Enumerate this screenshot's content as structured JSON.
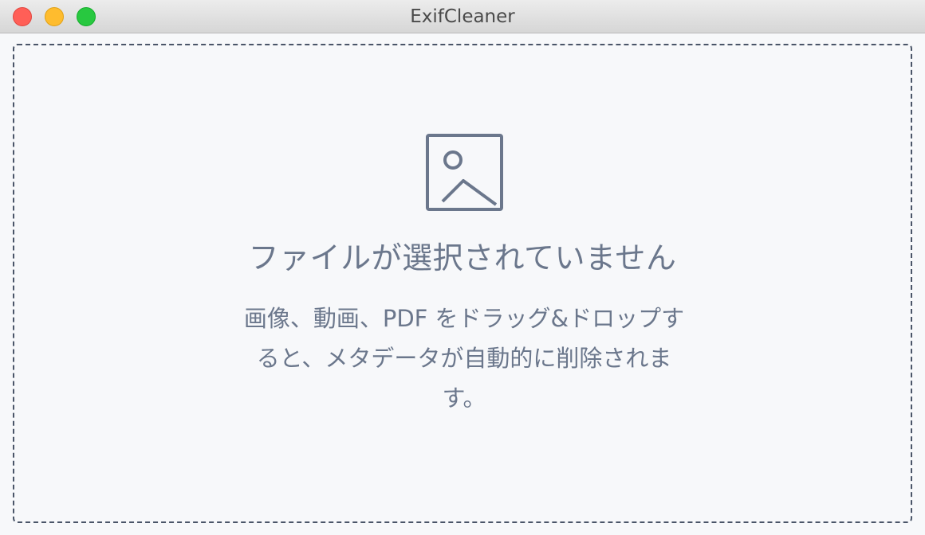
{
  "window": {
    "title": "ExifCleaner",
    "controls": [
      "close",
      "minimize",
      "zoom"
    ]
  },
  "dropzone": {
    "icon": "image-icon",
    "heading": "ファイルが選択されていません",
    "description": "画像、動画、PDF をドラッグ&ドロップすると、メタデータが自動的に削除されます。"
  },
  "colors": {
    "text": "#6b778c",
    "border": "#4a5568",
    "background": "#f7f8fa",
    "close": "#ff5f57",
    "minimize": "#febc2e",
    "zoom": "#28c840"
  }
}
